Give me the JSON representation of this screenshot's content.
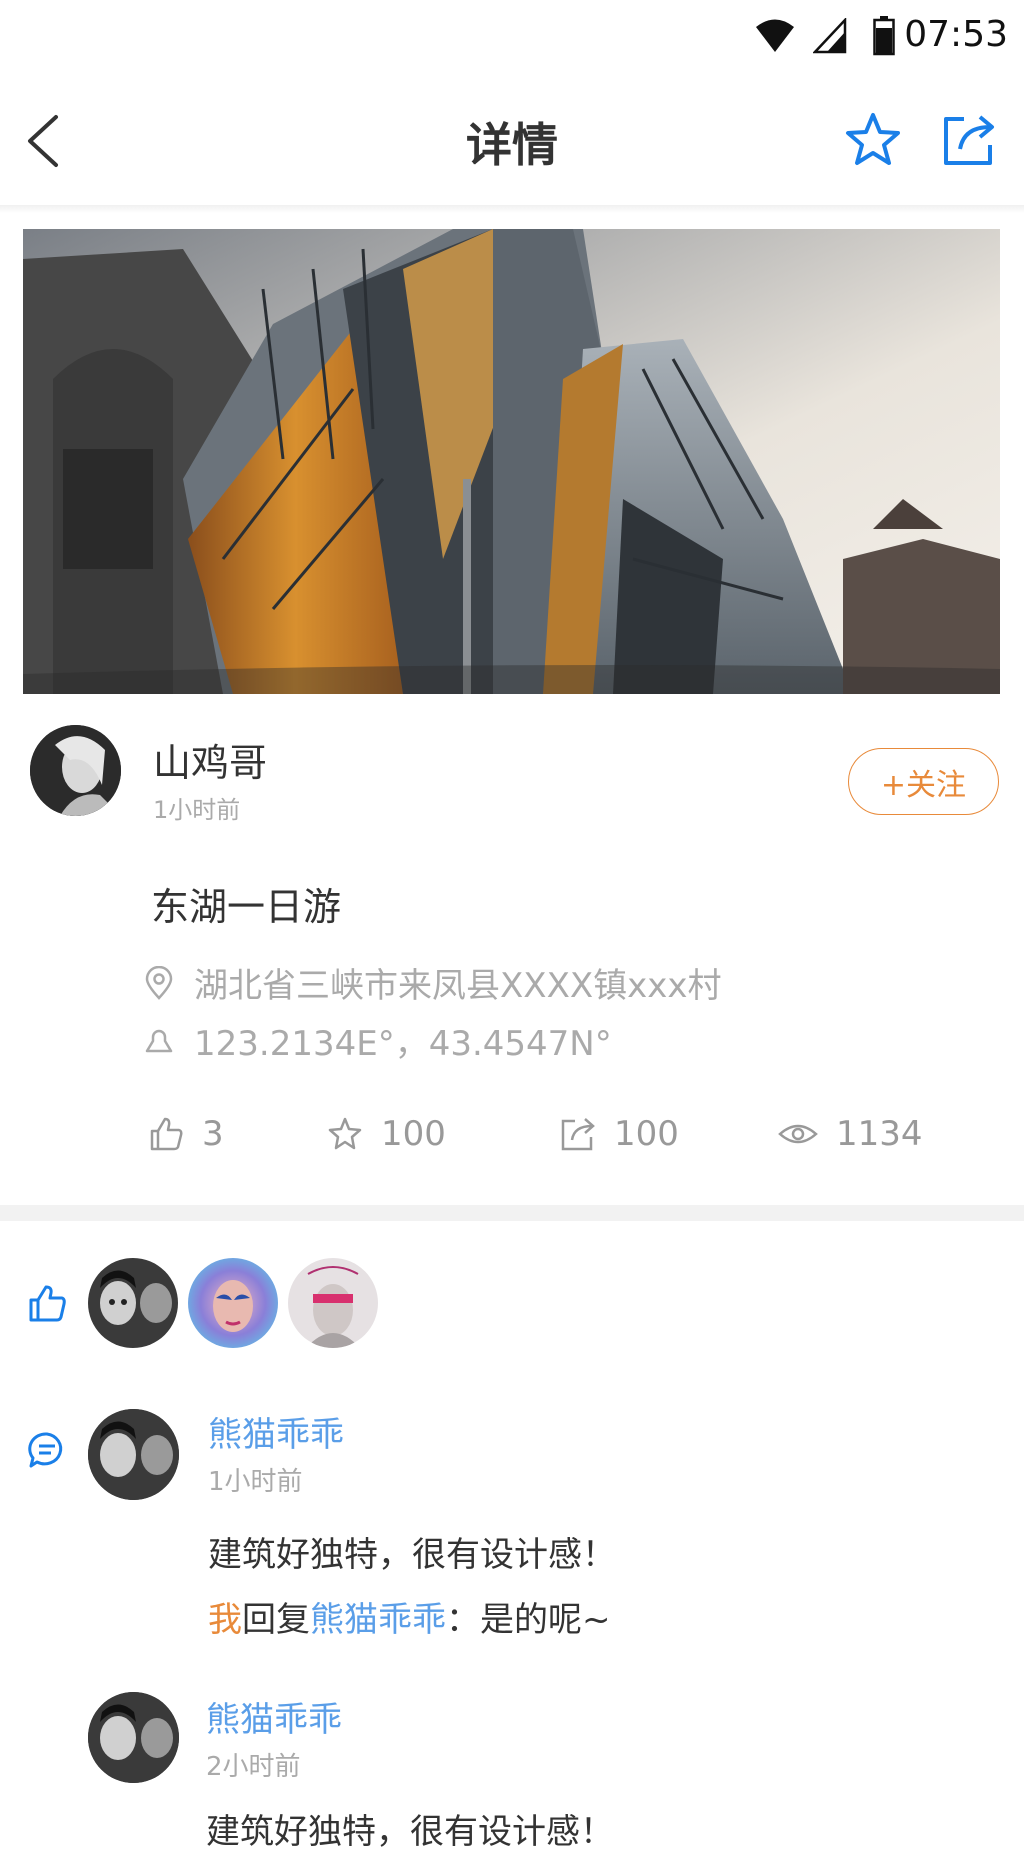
{
  "status": {
    "time": "07:53"
  },
  "nav": {
    "title": "详情"
  },
  "post": {
    "author": "山鸡哥",
    "time": "1小时前",
    "follow_label": "+关注",
    "title": "东湖一日游",
    "location": "湖北省三峡市来凤县XXXX镇xxx村",
    "coordinates": "123.2134E°，43.4547N°"
  },
  "stats": {
    "likes": "3",
    "favorites": "100",
    "shares": "100",
    "views": "1134"
  },
  "comments": [
    {
      "name": "熊猫乖乖",
      "time": "1小时前",
      "text": "建筑好独特，很有设计感！",
      "reply": {
        "me": "我",
        "verb": "回复",
        "target": "熊猫乖乖",
        "text": "：是的呢~"
      }
    },
    {
      "name": "熊猫乖乖",
      "time": "2小时前",
      "text": "建筑好独特，很有设计感！"
    }
  ],
  "colors": {
    "accent_blue": "#1a7fe8",
    "follow_orange": "#e88a3a",
    "name_blue": "#5a9ee8"
  }
}
